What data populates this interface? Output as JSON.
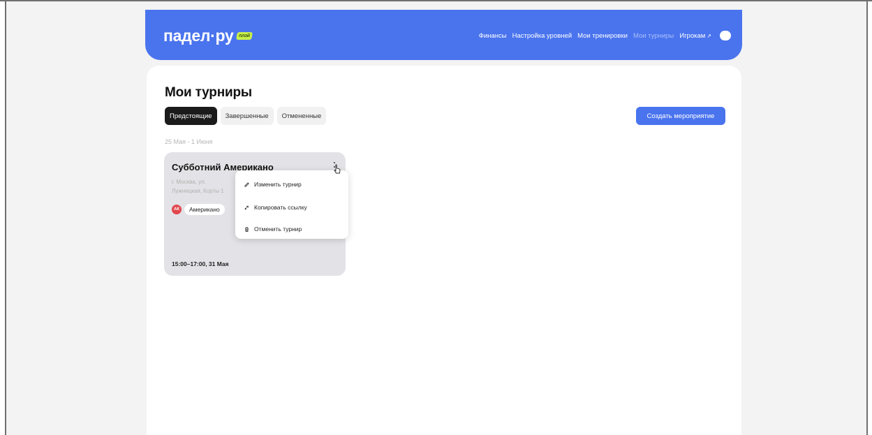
{
  "header": {
    "logo_text": "падел·ру",
    "logo_badge": "плэй",
    "nav": {
      "finances": "Финансы",
      "levels": "Настройка уровней",
      "trainings": "Мои тренировки",
      "tournaments": "Мои турниры",
      "players": "Игрокам",
      "players_arrow": "↗"
    }
  },
  "page": {
    "title": "Мои турниры",
    "tabs": {
      "upcoming": "Предстоящие",
      "finished": "Завершенные",
      "cancelled": "Отмененные"
    },
    "create_button": "Создать мероприятие",
    "date_range": "25 Мая - 1 Июня"
  },
  "card": {
    "title": "Субботний Американо",
    "address": "г. Москва, ул. Лужнецкая, Корты 1",
    "avatar_initials": "АК",
    "tag": "Американо",
    "time": "15:00–17:00, 31 Мая"
  },
  "menu": {
    "edit": "Изменить турнир",
    "copy_link": "Копировать ссылку",
    "cancel": "Отменить турнир"
  },
  "colors": {
    "accent": "#4a74ee",
    "badge": "#c9f04a",
    "avatar": "#e0474c",
    "card": "#e3e3e7",
    "active_tab": "#1b1b1b"
  },
  "icons": {
    "edit": "pencil-icon",
    "copy": "link-icon",
    "cancel": "trash-icon",
    "more": "more-vertical-icon",
    "cursor": "hand-cursor-icon"
  }
}
